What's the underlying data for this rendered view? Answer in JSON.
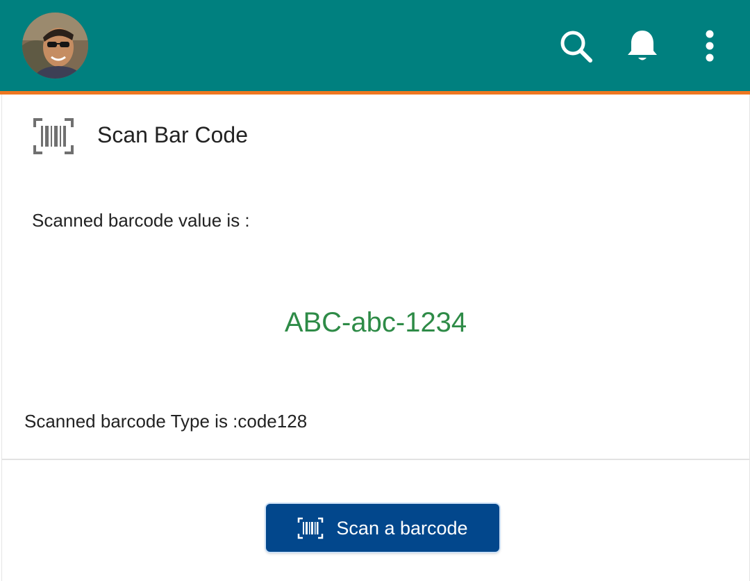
{
  "appbar": {
    "avatar_icon": "user-avatar",
    "actions": [
      {
        "icon": "search-icon"
      },
      {
        "icon": "bell-icon"
      },
      {
        "icon": "more-vertical-icon"
      }
    ],
    "colors": {
      "background": "#00807f",
      "accent_line": "#ee7720"
    }
  },
  "card": {
    "header_icon": "barcode-scan-icon",
    "title": "Scan Bar Code",
    "value_label": "Scanned barcode value is :",
    "value": "ABC-abc-1234",
    "type_text": "Scanned barcode Type is :code128",
    "colors": {
      "value_text": "#2e8b47"
    }
  },
  "action_button": {
    "icon": "barcode-scan-icon",
    "label": "Scan a barcode",
    "color": "#02478c"
  }
}
